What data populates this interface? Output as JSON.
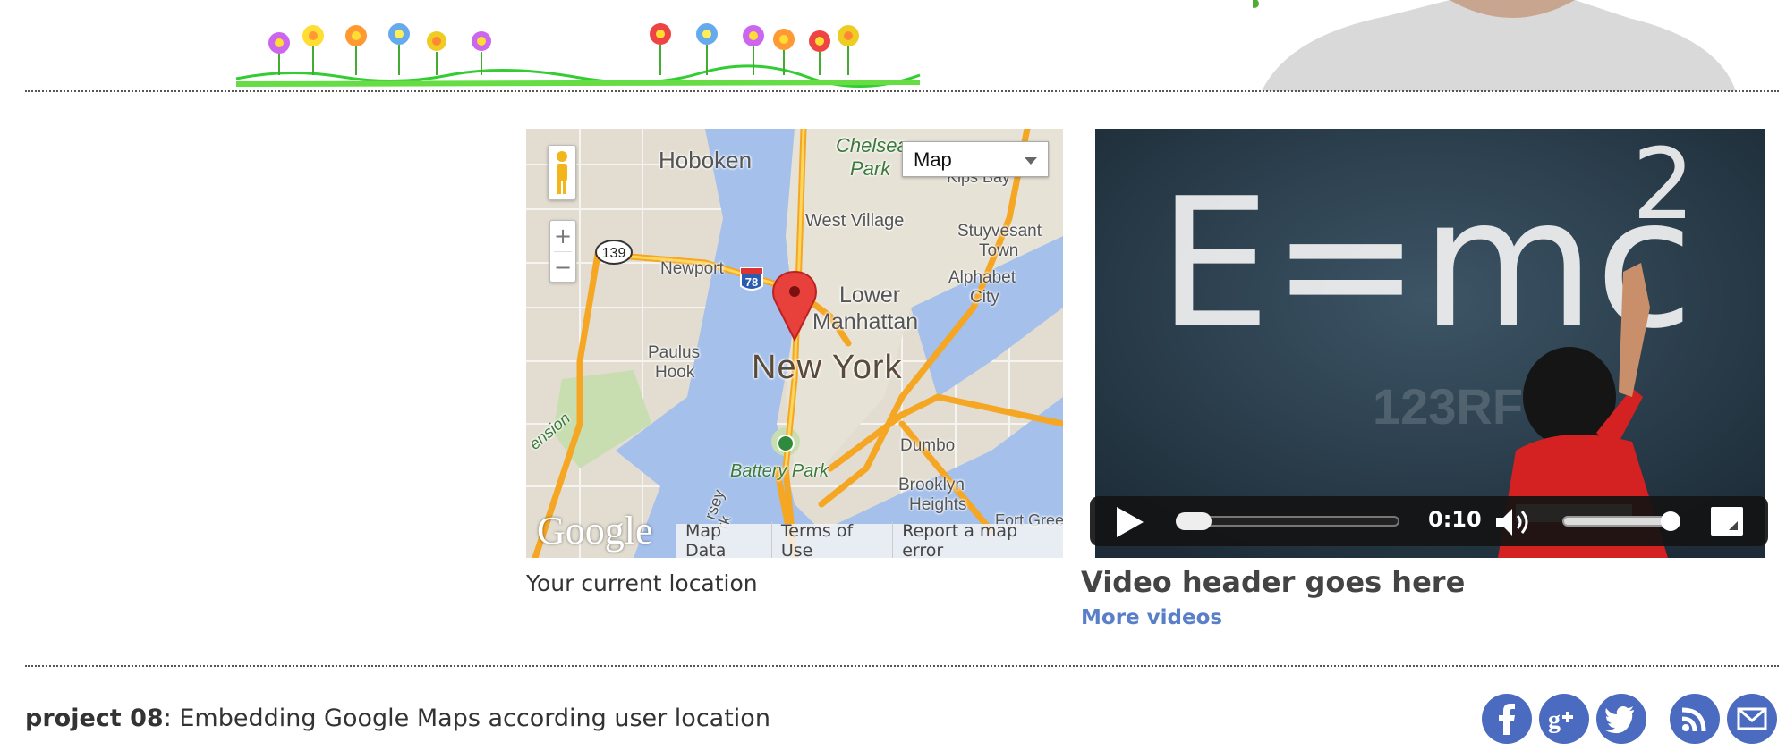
{
  "map": {
    "type_select": "Map",
    "labels": {
      "hoboken": "Hoboken",
      "chelsea": "Chelsea",
      "park": "Park",
      "kips_bay": "Kips Bay",
      "west_village": "West Village",
      "stuyvesant": "Stuyvesant",
      "town": "Town",
      "newport": "Newport",
      "alphabet": "Alphabet",
      "city": "City",
      "lower": "Lower",
      "manhattan": "Manhattan",
      "paulus": "Paulus",
      "hook": "Hook",
      "new_york": "New York",
      "dumbo": "Dumbo",
      "battery_park": "Battery Park",
      "brooklyn": "Brooklyn",
      "heights": "Heights",
      "fort_greene": "Fort Greene",
      "extension": "ension",
      "jersey": "rsey",
      "city_k": "rk",
      "route_139": "139",
      "route_78": "78"
    },
    "footer": {
      "map_data": "Map Data",
      "terms": "Terms of Use",
      "report": "Report a map error"
    },
    "logo": "Google",
    "caption": "Your current location"
  },
  "video": {
    "board_text": "E=mc",
    "board_sup": "2",
    "watermark": "123RF",
    "time": "0:10",
    "progress": 0.05,
    "volume": 0.95,
    "title": "Video header goes here",
    "more_link": "More videos"
  },
  "footer": {
    "project_label": "project 08",
    "description": ": Embedding Google Maps according user location",
    "social_icons": [
      "facebook-icon",
      "google-plus-icon",
      "twitter-icon",
      "rss-icon",
      "email-icon"
    ]
  },
  "colors": {
    "social": "#4a6bbf",
    "link": "#5a7fc9",
    "water": "#a4c0eb",
    "road": "#f5a623"
  }
}
